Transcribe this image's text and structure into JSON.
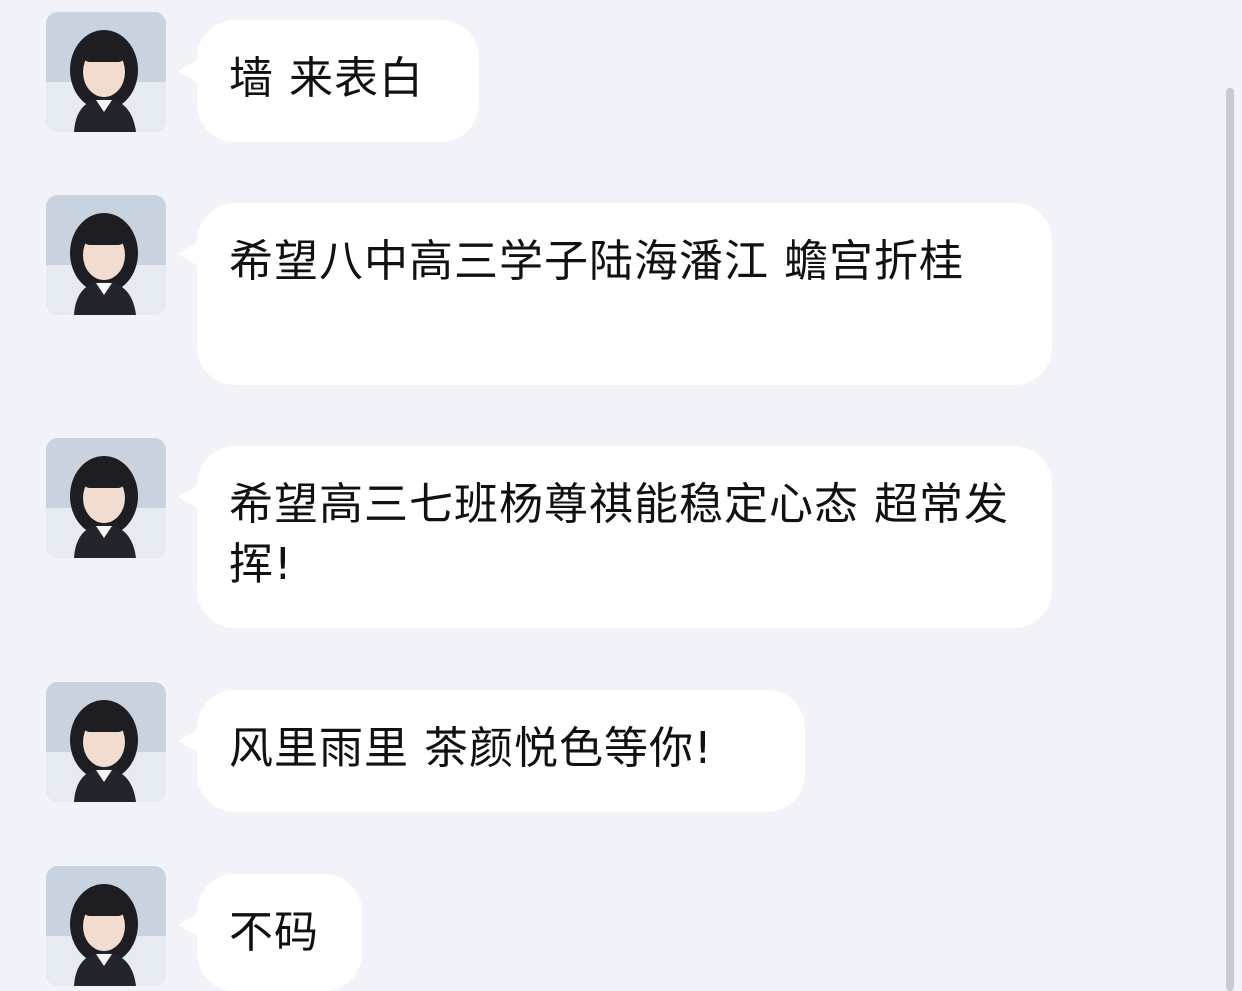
{
  "messages": [
    {
      "text": "墙 来表白"
    },
    {
      "text": "希望八中高三学子陆海潘江 蟾宫折桂"
    },
    {
      "text": "希望高三七班杨尊祺能稳定心态 超常发挥!"
    },
    {
      "text": "风里雨里 茶颜悦色等你!"
    },
    {
      "text": "不码"
    }
  ],
  "avatar": {
    "icon": "user-avatar-photo"
  },
  "colors": {
    "background": "#f2f3f8",
    "bubble": "#ffffff",
    "text": "#111111",
    "scrollbar": "#c8cacf"
  }
}
